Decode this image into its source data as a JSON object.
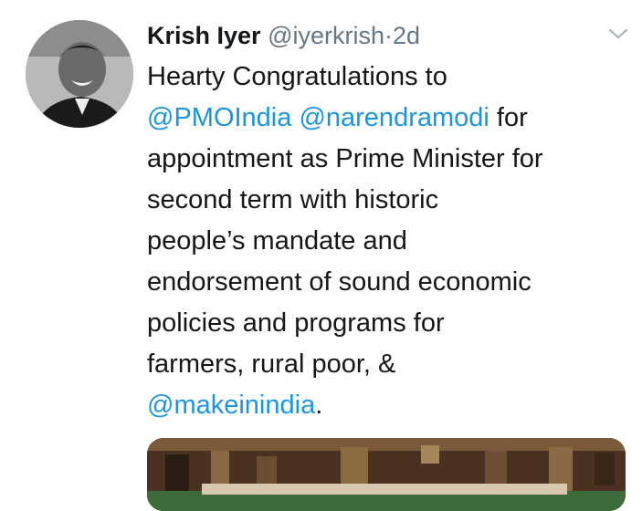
{
  "tweet": {
    "author": {
      "name": "Krish Iyer",
      "handle": "@iyerkrish",
      "separator": "·",
      "time": "2d"
    },
    "text_lines": {
      "l1": "Hearty Congratulations to",
      "l2_m1": "@PMOIndia",
      "l2_m2": "@narendramodi",
      "l2_rest": "for",
      "l3": "appointment as Prime Minister for",
      "l4": "second term with historic",
      "l5": "people’s mandate and",
      "l6": "endorsement of sound economic",
      "l7": "policies and programs for",
      "l8": "farmers, rural poor, &",
      "l9_m": "@makeinindia",
      "l9_end": "."
    },
    "colors": {
      "link": "#1b95e0",
      "muted": "#657786",
      "text": "#14171a"
    },
    "icons": {
      "menu": "chevron-down-icon",
      "avatar": "profile-photo"
    }
  }
}
